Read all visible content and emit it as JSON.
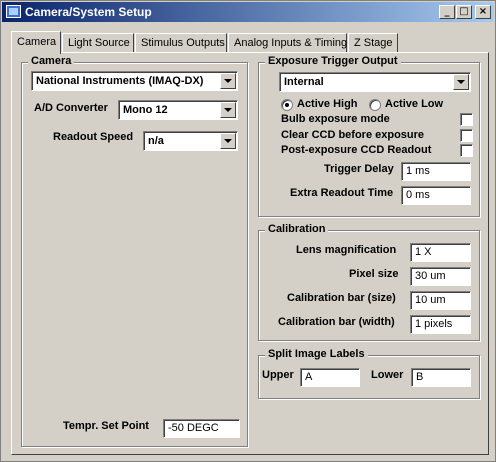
{
  "window": {
    "title": "Camera/System Setup",
    "minimize_glyph": "_",
    "maximize_glyph": "□",
    "close_glyph": "×"
  },
  "tabs": [
    {
      "label": "Camera",
      "active": true
    },
    {
      "label": "Light Source",
      "active": false
    },
    {
      "label": "Stimulus Outputs",
      "active": false
    },
    {
      "label": "Analog Inputs & Timing",
      "active": false
    },
    {
      "label": "Z Stage",
      "active": false
    }
  ],
  "camera": {
    "group_title": "Camera",
    "device": "National Instruments (IMAQ-DX)",
    "ad_converter_label": "A/D Converter",
    "ad_converter_value": "Mono 12",
    "readout_speed_label": "Readout Speed",
    "readout_speed_value": "n/a",
    "temp_setpoint_label": "Tempr. Set Point",
    "temp_setpoint_value": "-50 DEGC"
  },
  "trigger": {
    "group_title": "Exposure Trigger Output",
    "mode": "Internal",
    "active_high_label": "Active High",
    "active_low_label": "Active Low",
    "active_high_selected": true,
    "bulb_label": "Bulb exposure mode",
    "clear_ccd_label": "Clear CCD before exposure",
    "post_exposure_label": "Post-exposure CCD Readout",
    "trigger_delay_label": "Trigger Delay",
    "trigger_delay_value": "1 ms",
    "extra_readout_label": "Extra Readout Time",
    "extra_readout_value": "0 ms"
  },
  "calibration": {
    "group_title": "Calibration",
    "lens_label": "Lens magnification",
    "lens_value": "1 X",
    "pixel_label": "Pixel size",
    "pixel_value": "30 um",
    "bar_size_label": "Calibration bar (size)",
    "bar_size_value": "10 um",
    "bar_width_label": "Calibration bar (width)",
    "bar_width_value": "1 pixels"
  },
  "split": {
    "group_title": "Split Image Labels",
    "upper_label": "Upper",
    "upper_value": "A",
    "lower_label": "Lower",
    "lower_value": "B"
  }
}
